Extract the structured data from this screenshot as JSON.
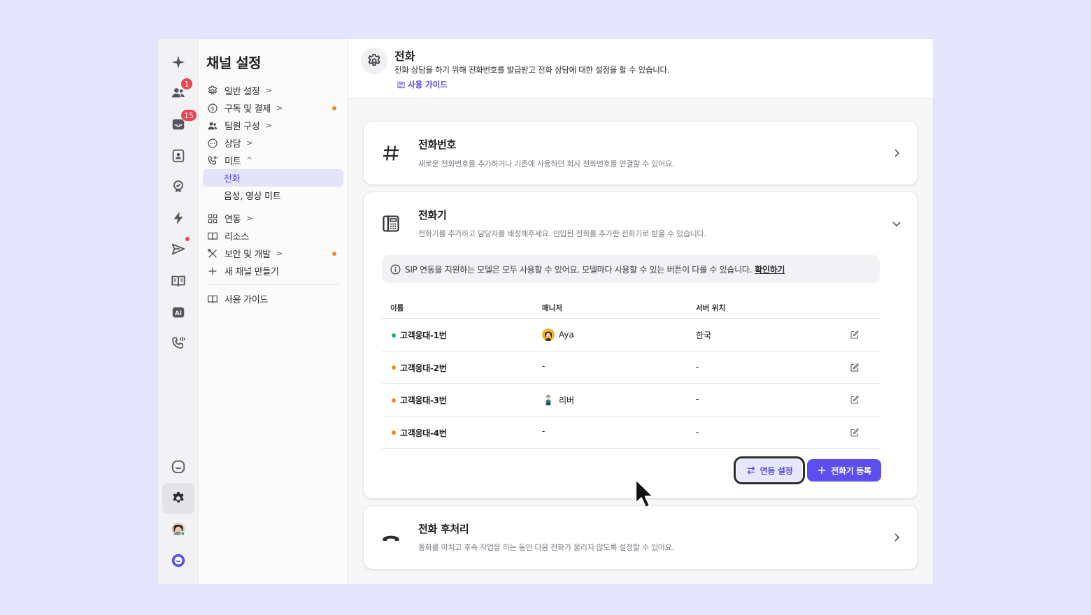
{
  "rail": {
    "badges": {
      "users": "1",
      "inbox": "15"
    }
  },
  "nav": {
    "title": "채널 설정",
    "items": [
      {
        "label": "일반 설정",
        "icon": "gear-icon"
      },
      {
        "label": "구독 및 결제",
        "icon": "dollar-circle-icon"
      },
      {
        "label": "팀원 구성",
        "icon": "team-icon"
      },
      {
        "label": "상담",
        "icon": "chat-bubble-icon"
      },
      {
        "label": "미트",
        "icon": "phone-wave-icon"
      },
      {
        "label": "전화"
      },
      {
        "label": "음성, 영상 미트"
      },
      {
        "label": "연동",
        "icon": "grid-icon"
      },
      {
        "label": "리소스",
        "icon": "book-icon"
      },
      {
        "label": "보안 및 개발",
        "icon": "tools-icon"
      },
      {
        "label": "새 채널 만들기",
        "icon": "plus-icon"
      },
      {
        "label": "사용 가이드",
        "icon": "book-icon"
      }
    ]
  },
  "header": {
    "title": "전화",
    "description": "전화 상담을 하기 위해 전화번호를 발급받고 전화 상담에 대한 설정을 할 수 있습니다.",
    "guide_link": "사용 가이드"
  },
  "cards": {
    "phone_number": {
      "title": "전화번호",
      "description": "새로운 전화번호를 추가하거나 기존에 사용하던 회사 전화번호를 연결할 수 있어요."
    },
    "devices": {
      "title": "전화기",
      "description": "전화기를 추가하고 담당자를 배정해주세요. 인입된 전화를 추가한 전화기로 받을 수 있습니다.",
      "notice": "SIP 연동을 지원하는 모델은 모두 사용할 수 있어요. 모델마다 사용할 수 있는 버튼이 다를 수 있습니다.",
      "notice_link": "확인하기",
      "columns": [
        "이름",
        "매니저",
        "서버 위치"
      ],
      "rows": [
        {
          "name": "고객응대-1번",
          "status_color": "#22b35e",
          "manager": "Aya",
          "location": "한국"
        },
        {
          "name": "고객응대-2번",
          "status_color": "#f08a24",
          "manager": "-",
          "location": "-"
        },
        {
          "name": "고객응대-3번",
          "status_color": "#f08a24",
          "manager": "리버",
          "location": "-"
        },
        {
          "name": "고객응대-4번",
          "status_color": "#f08a24",
          "manager": "-",
          "location": "-"
        }
      ],
      "integration_button": "연동 설정",
      "register_button": "전화기 등록"
    },
    "after_call": {
      "title": "전화 후처리",
      "description": "통화를 마치고 후속 작업을 하는 동안 다음 전화가 울리지 않도록 설정할 수 있어요."
    }
  },
  "colors": {
    "accent": "#5b4ff0",
    "accent_text": "#5046d8",
    "badge_red": "#e8454f",
    "status_orange": "#f08a24",
    "status_green": "#22b35e"
  }
}
